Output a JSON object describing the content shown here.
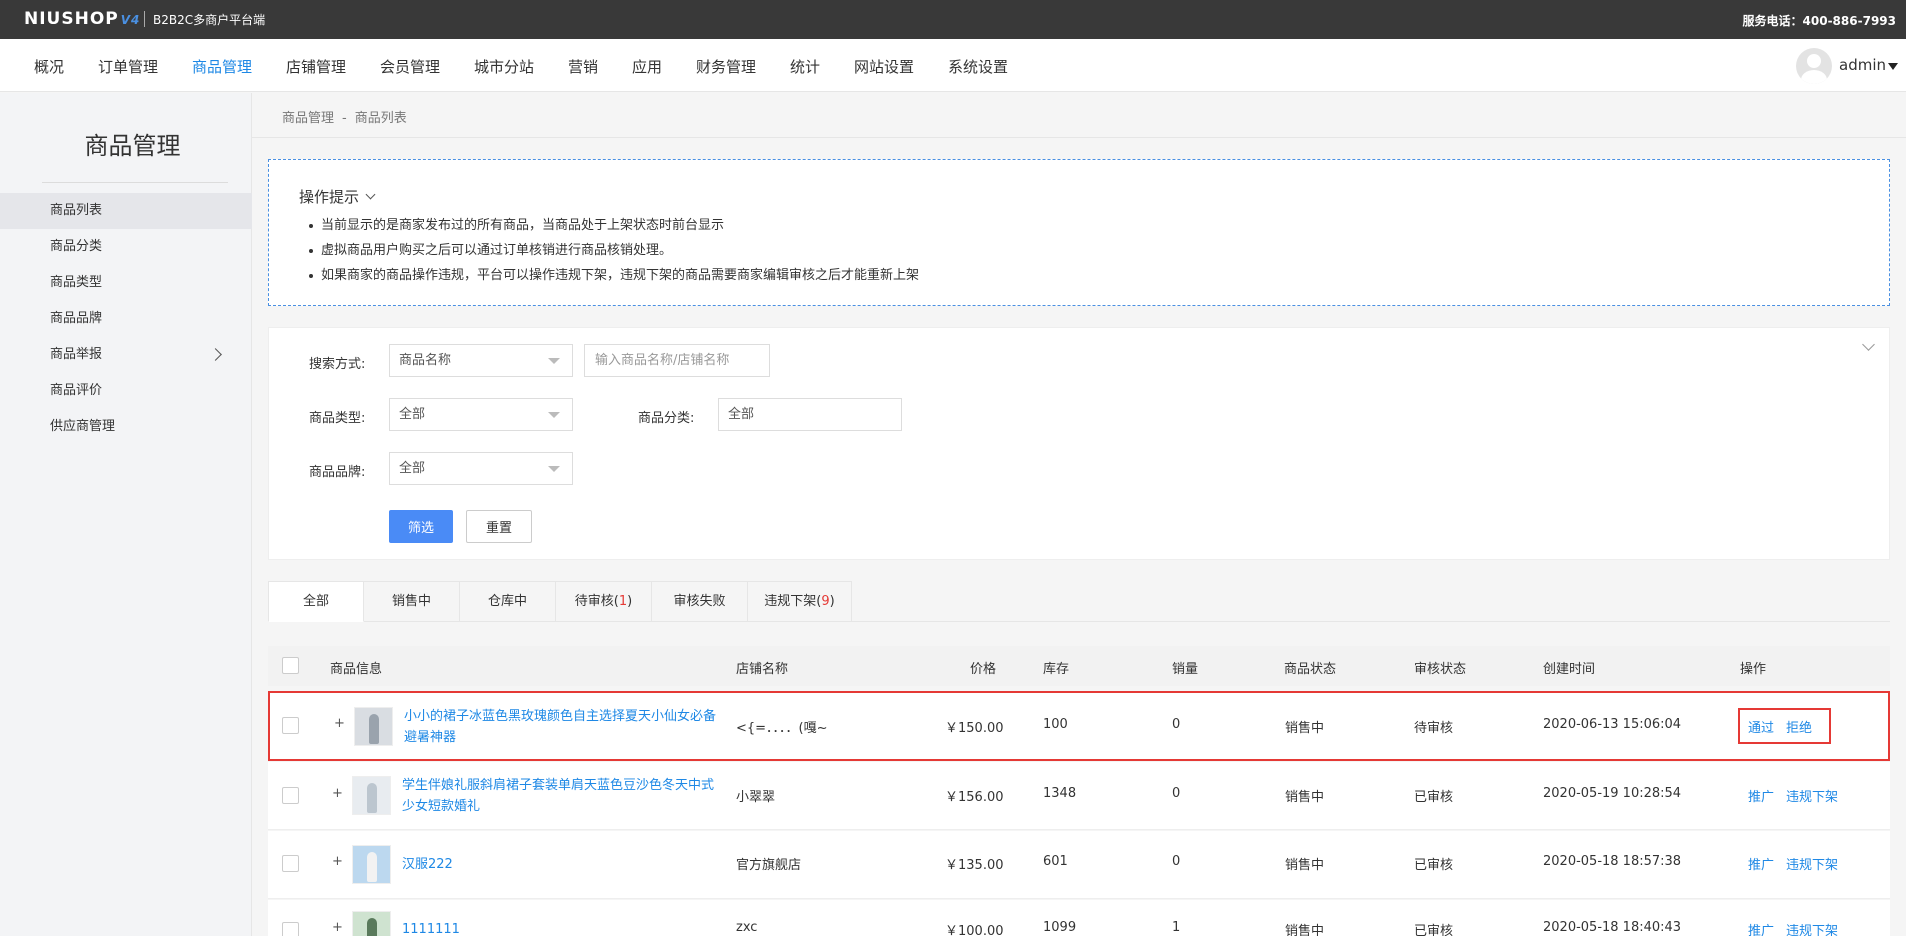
{
  "header": {
    "logo": "NIUSHOP",
    "logo_version": "V4",
    "subtitle": "B2B2C多商户平台端",
    "hotline": "服务电话：400-886-7993"
  },
  "nav": {
    "items": [
      {
        "label": "概况"
      },
      {
        "label": "订单管理"
      },
      {
        "label": "商品管理",
        "active": true
      },
      {
        "label": "店铺管理"
      },
      {
        "label": "会员管理"
      },
      {
        "label": "城市分站"
      },
      {
        "label": "营销"
      },
      {
        "label": "应用"
      },
      {
        "label": "财务管理"
      },
      {
        "label": "统计"
      },
      {
        "label": "网站设置"
      },
      {
        "label": "系统设置"
      }
    ],
    "user": "admin"
  },
  "sidebar": {
    "title": "商品管理",
    "items": [
      {
        "label": "商品列表",
        "active": true
      },
      {
        "label": "商品分类"
      },
      {
        "label": "商品类型"
      },
      {
        "label": "商品品牌"
      },
      {
        "label": "商品举报",
        "has_children": true
      },
      {
        "label": "商品评价"
      },
      {
        "label": "供应商管理"
      }
    ]
  },
  "breadcrumb": {
    "parent": "商品管理",
    "separator": "-",
    "current": "商品列表"
  },
  "tips": {
    "title": "操作提示",
    "items": [
      "当前显示的是商家发布过的所有商品，当商品处于上架状态时前台显示",
      "虚拟商品用户购买之后可以通过订单核销进行商品核销处理。",
      "如果商家的商品操作违规，平台可以操作违规下架，违规下架的商品需要商家编辑审核之后才能重新上架"
    ]
  },
  "filter": {
    "search_mode_label": "搜索方式:",
    "search_mode_value": "商品名称",
    "search_placeholder": "输入商品名称/店铺名称",
    "goods_type_label": "商品类型:",
    "goods_type_value": "全部",
    "category_label": "商品分类:",
    "category_value": "全部",
    "brand_label": "商品品牌:",
    "brand_value": "全部",
    "submit_label": "筛选",
    "reset_label": "重置"
  },
  "tabs": [
    {
      "label": "全部",
      "active": true
    },
    {
      "label": "销售中"
    },
    {
      "label": "仓库中"
    },
    {
      "label": "待审核",
      "count": "1"
    },
    {
      "label": "审核失败"
    },
    {
      "label": "违规下架",
      "count": "9"
    }
  ],
  "table": {
    "columns": [
      "商品信息",
      "店铺名称",
      "价格",
      "库存",
      "销量",
      "商品状态",
      "审核状态",
      "创建时间",
      "操作"
    ],
    "rows": [
      {
        "name": "小小的裙子冰蓝色黑玫瑰颜色自主选择夏天小仙女必备避暑神器",
        "shop": "<{=．．．．(嘎~",
        "price": "￥150.00",
        "stock": "100",
        "sales": "0",
        "status": "销售中",
        "audit": "待审核",
        "created": "2020-06-13 15:06:04",
        "actions": [
          "通过",
          "拒绝"
        ],
        "highlight": true
      },
      {
        "name": "学生伴娘礼服斜肩裙子套装单肩天蓝色豆沙色冬天中式少女短款婚礼",
        "shop": "小翠翠",
        "price": "￥156.00",
        "stock": "1348",
        "sales": "0",
        "status": "销售中",
        "audit": "已审核",
        "created": "2020-05-19 10:28:54",
        "actions": [
          "推广",
          "违规下架"
        ]
      },
      {
        "name": "汉服222",
        "shop": "官方旗舰店",
        "price": "￥135.00",
        "stock": "601",
        "sales": "0",
        "status": "销售中",
        "audit": "已审核",
        "created": "2020-05-18 18:57:38",
        "actions": [
          "推广",
          "违规下架"
        ]
      },
      {
        "name": "1111111",
        "shop": "zxc",
        "price": "￥100.00",
        "stock": "1099",
        "sales": "1",
        "status": "销售中",
        "audit": "已审核",
        "created": "2020-05-18 18:40:43",
        "actions": [
          "推广",
          "违规下架"
        ]
      }
    ]
  },
  "colors": {
    "accent": "#1e88e5",
    "primary_button": "#4a8bf6",
    "highlight": "#e53935",
    "topbar": "#393939"
  }
}
